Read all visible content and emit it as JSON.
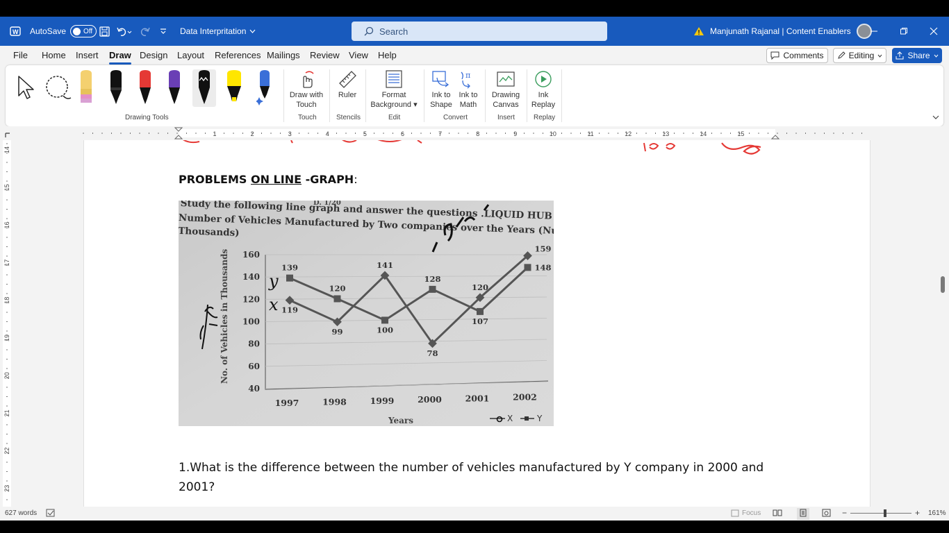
{
  "titlebar": {
    "autosave_label": "AutoSave",
    "autosave_state": "Off",
    "doc_name": "Data Interpritation",
    "search_placeholder": "Search",
    "user_name": "Manjunath Rajanal | Content Enablers"
  },
  "menu": {
    "tabs": [
      "File",
      "Home",
      "Insert",
      "Draw",
      "Design",
      "Layout",
      "References",
      "Mailings",
      "Review",
      "View",
      "Help"
    ],
    "active_tab": "Draw",
    "comments_label": "Comments",
    "editing_label": "Editing",
    "share_label": "Share"
  },
  "ribbon": {
    "groups": {
      "drawing_tools": "Drawing Tools",
      "touch": "Touch",
      "stencils": "Stencils",
      "edit": "Edit",
      "convert": "Convert",
      "insert": "Insert",
      "replay": "Replay"
    },
    "tools": {
      "draw_with_touch": [
        "Draw with",
        "Touch"
      ],
      "ruler": "Ruler",
      "format_background": [
        "Format",
        "Background"
      ],
      "ink_to_shape": [
        "Ink to",
        "Shape"
      ],
      "ink_to_math": [
        "Ink to",
        "Math"
      ],
      "drawing_canvas": [
        "Drawing",
        "Canvas"
      ],
      "ink_replay": [
        "Ink",
        "Replay"
      ]
    },
    "pen_colors": [
      "#f4d06f",
      "#111111",
      "#e53935",
      "#6a3fb5",
      "#111111",
      "#ffe600",
      "#3a6fd8"
    ]
  },
  "ruler": {
    "h_numbers": [
      "1",
      "2",
      "3",
      "4",
      "5",
      "6",
      "7",
      "8",
      "9",
      "10",
      "11",
      "12",
      "13",
      "14",
      "15"
    ],
    "v_numbers": [
      "14",
      "15",
      "16",
      "17",
      "18",
      "19",
      "20",
      "21",
      "22",
      "23"
    ]
  },
  "document": {
    "heading_pre": "PROBLEMS ",
    "heading_ul": "ON LINE",
    "heading_post": " -GRAPH",
    "heading_colon": ":",
    "scanned": {
      "top_fragment": "D. 1/20",
      "instruction": "Study the following line graph and answer the questions .LIQUID HUB",
      "subtitle": "Number of Vehicles Manufactured by Two companies over the Years (Number in Thousands)",
      "ylabel": "No. of Vehicles in Thousands",
      "xlabel": "Years",
      "legend_x": "X",
      "legend_y": "Y",
      "handwritten": [
        "y",
        "x"
      ]
    },
    "question": "1.What is the difference between the number of vehicles manufactured by Y company in 2000 and 2001?"
  },
  "chart_data": {
    "type": "line",
    "x": [
      "1997",
      "1998",
      "1999",
      "2000",
      "2001",
      "2002"
    ],
    "series": [
      {
        "name": "X",
        "values": [
          119,
          99,
          141,
          78,
          120,
          159
        ]
      },
      {
        "name": "Y",
        "values": [
          139,
          120,
          100,
          128,
          107,
          148
        ]
      }
    ],
    "ylim": [
      40,
      160
    ],
    "yticks": [
      40,
      60,
      80,
      100,
      120,
      140,
      160
    ],
    "xlabel": "Years",
    "ylabel": "No. of Vehicles in Thousands",
    "legend": "bottom-right"
  },
  "status": {
    "words": "627 words",
    "focus": "Focus",
    "zoom": "161%"
  }
}
